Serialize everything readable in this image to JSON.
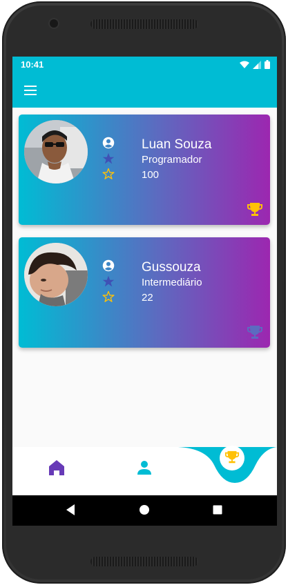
{
  "status_bar": {
    "time": "10:41",
    "icons": [
      "wifi-icon",
      "signal-icon",
      "battery-icon"
    ]
  },
  "app_bar": {
    "menu_icon": "menu-icon",
    "color": "#00bcd4"
  },
  "cards": [
    {
      "name": "Luan Souza",
      "level": "Programador",
      "points": "100",
      "trophy_color": "#ffc107",
      "icons": [
        "account-circle-icon",
        "star-filled-icon",
        "star-outline-icon",
        "trophy-icon"
      ]
    },
    {
      "name": "Gussouza",
      "level": "Intermediário",
      "points": "22",
      "trophy_color": "#5c6bc0",
      "icons": [
        "account-circle-icon",
        "star-filled-icon",
        "star-outline-icon",
        "trophy-icon"
      ]
    }
  ],
  "bottom_nav": {
    "items": [
      "home-icon",
      "person-icon",
      "trophy-icon"
    ],
    "active": "trophy-icon",
    "home_color": "#673ab7",
    "person_color": "#00bcd4",
    "trophy_color": "#ffc107"
  },
  "system_nav": [
    "back-icon",
    "home-circle-icon",
    "recents-icon"
  ],
  "colors": {
    "primary": "#00bcd4",
    "gradient_end": "#9c27b0",
    "star_filled": "#3f51b5",
    "star_outline": "#ffc107"
  }
}
